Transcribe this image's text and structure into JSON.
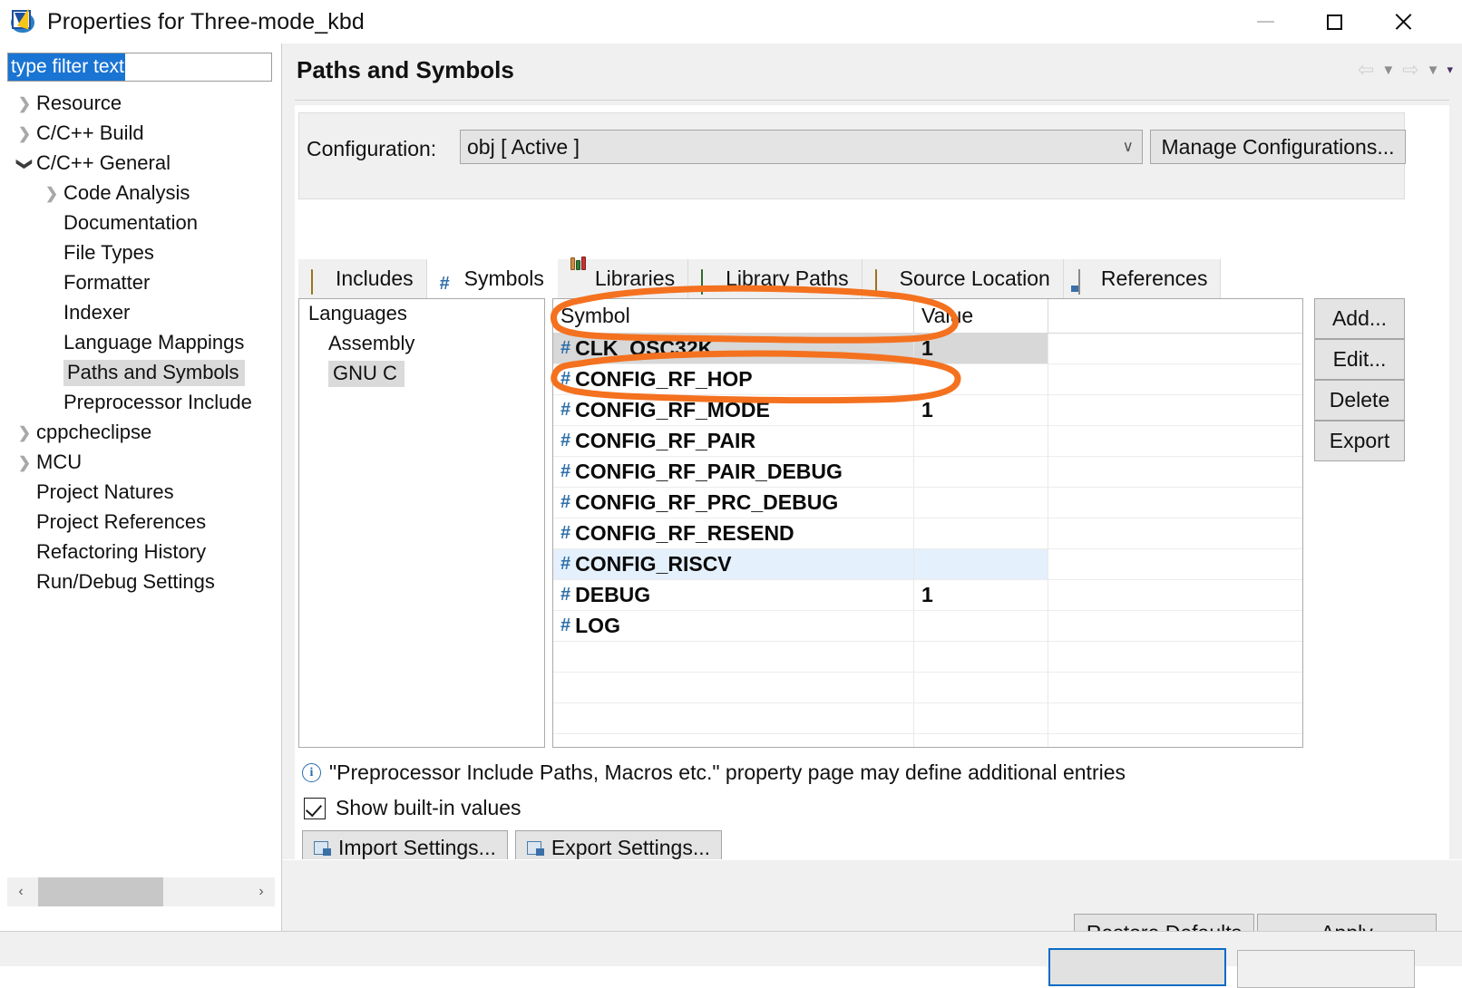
{
  "window": {
    "title": "Properties for Three-mode_kbd",
    "app_icon": "eclipse-checkmark-icon",
    "minimize_label": "—",
    "maximize_label": "□",
    "close_label": "✕"
  },
  "sidebar": {
    "filter": {
      "value": "type filter text",
      "placeholder": "type filter text",
      "selected": true
    },
    "tree": [
      {
        "label": "Resource",
        "depth": 0,
        "chevron": "collapsed",
        "selected": false
      },
      {
        "label": "C/C++ Build",
        "depth": 0,
        "chevron": "collapsed",
        "selected": false
      },
      {
        "label": "C/C++ General",
        "depth": 0,
        "chevron": "expanded",
        "selected": false
      },
      {
        "label": "Code Analysis",
        "depth": 1,
        "chevron": "collapsed",
        "selected": false
      },
      {
        "label": "Documentation",
        "depth": 1,
        "chevron": "none",
        "selected": false
      },
      {
        "label": "File Types",
        "depth": 1,
        "chevron": "none",
        "selected": false
      },
      {
        "label": "Formatter",
        "depth": 1,
        "chevron": "none",
        "selected": false
      },
      {
        "label": "Indexer",
        "depth": 1,
        "chevron": "none",
        "selected": false
      },
      {
        "label": "Language Mappings",
        "depth": 1,
        "chevron": "none",
        "selected": false
      },
      {
        "label": "Paths and Symbols",
        "depth": 1,
        "chevron": "none",
        "selected": true
      },
      {
        "label": "Preprocessor Include",
        "depth": 1,
        "chevron": "none",
        "selected": false
      },
      {
        "label": "cppcheclipse",
        "depth": 0,
        "chevron": "collapsed",
        "selected": false
      },
      {
        "label": "MCU",
        "depth": 0,
        "chevron": "collapsed",
        "selected": false
      },
      {
        "label": "Project Natures",
        "depth": 0,
        "chevron": "none",
        "selected": false
      },
      {
        "label": "Project References",
        "depth": 0,
        "chevron": "none",
        "selected": false
      },
      {
        "label": "Refactoring History",
        "depth": 0,
        "chevron": "none",
        "selected": false
      },
      {
        "label": "Run/Debug Settings",
        "depth": 0,
        "chevron": "none",
        "selected": false
      }
    ],
    "scroll_left_label": "‹",
    "scroll_right_label": "›"
  },
  "page": {
    "title": "Paths and Symbols",
    "nav": {
      "back_label": "⇦",
      "back_menu_label": "▼",
      "forward_label": "⇨",
      "forward_menu_label": "▼",
      "overflow_label": "▾"
    }
  },
  "configuration": {
    "label": "Configuration:",
    "value": "obj  [ Active ]",
    "dropdown_arrow": "∨",
    "manage_label": "Manage Configurations..."
  },
  "tabs": [
    {
      "label": "Includes",
      "icon": "folder-icon",
      "active": false
    },
    {
      "label": "Symbols",
      "icon": "hash-icon",
      "active": true
    },
    {
      "label": "Libraries",
      "icon": "books-icon",
      "active": false
    },
    {
      "label": "Library Paths",
      "icon": "folder-green-icon",
      "active": false
    },
    {
      "label": "Source Location",
      "icon": "folder-icon",
      "active": false
    },
    {
      "label": "References",
      "icon": "document-icon",
      "active": false
    }
  ],
  "languages": {
    "header": "Languages",
    "items": [
      {
        "label": "Assembly",
        "selected": false
      },
      {
        "label": "GNU C",
        "selected": true
      }
    ]
  },
  "symbols_table": {
    "columns": [
      "Symbol",
      "Value"
    ],
    "rows": [
      {
        "symbol": "CLK_OSC32K",
        "value": "1",
        "state": "selected",
        "annotated": true
      },
      {
        "symbol": "CONFIG_RF_HOP",
        "value": "",
        "state": "normal",
        "annotated": false
      },
      {
        "symbol": "CONFIG_RF_MODE",
        "value": "1",
        "state": "normal",
        "annotated": true
      },
      {
        "symbol": "CONFIG_RF_PAIR",
        "value": "",
        "state": "normal",
        "annotated": false
      },
      {
        "symbol": "CONFIG_RF_PAIR_DEBUG",
        "value": "",
        "state": "normal",
        "annotated": false
      },
      {
        "symbol": "CONFIG_RF_PRC_DEBUG",
        "value": "",
        "state": "normal",
        "annotated": false
      },
      {
        "symbol": "CONFIG_RF_RESEND",
        "value": "",
        "state": "normal",
        "annotated": false
      },
      {
        "symbol": "CONFIG_RISCV",
        "value": "",
        "state": "hovered",
        "annotated": false
      },
      {
        "symbol": "DEBUG",
        "value": "1",
        "state": "normal",
        "annotated": false
      },
      {
        "symbol": "LOG",
        "value": "",
        "state": "normal",
        "annotated": false
      }
    ],
    "empty_row_count": 5,
    "symbol_prefix": "#"
  },
  "action_buttons": [
    {
      "label": "Add..."
    },
    {
      "label": "Edit..."
    },
    {
      "label": "Delete"
    },
    {
      "label": "Export"
    }
  ],
  "notes": {
    "info_icon": "info-icon",
    "info_text": "\"Preprocessor Include Paths, Macros etc.\" property page may define additional entries",
    "checkbox_label": "Show built-in values",
    "checkbox_checked": true
  },
  "settings_buttons": [
    {
      "label": "Import Settings...",
      "icon": "import-icon"
    },
    {
      "label": "Export Settings...",
      "icon": "export-icon"
    }
  ],
  "footer": {
    "restore_label": "Restore Defaults",
    "apply_label": "Apply"
  },
  "annotation": {
    "color": "#F4711F",
    "shapes": [
      "ellipse-around-clk-osc32k-row",
      "ellipse-around-config-rf-mode-row"
    ]
  }
}
